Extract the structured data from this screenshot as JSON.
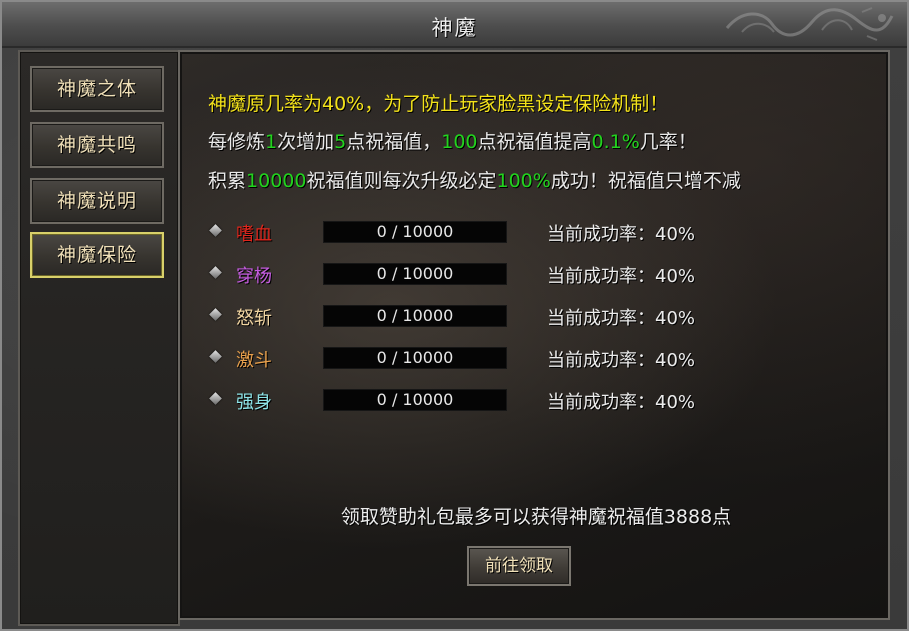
{
  "window": {
    "title": "神魔"
  },
  "sidebar": {
    "items": [
      {
        "label": "神魔之体"
      },
      {
        "label": "神魔共鸣"
      },
      {
        "label": "神魔说明"
      },
      {
        "label": "神魔保险"
      }
    ]
  },
  "intro": {
    "line1": "神魔原几率为40%，为了防止玩家脸黑设定保险机制！",
    "line2_a": "每修炼",
    "line2_b": "1",
    "line2_c": "次增加",
    "line2_d": "5",
    "line2_e": "点祝福值，",
    "line2_f": "100",
    "line2_g": "点祝福值提高",
    "line2_h": "0.1%",
    "line2_i": "几率！",
    "line3_a": "积累",
    "line3_b": "10000",
    "line3_c": "祝福值则每次升级必定",
    "line3_d": "100%",
    "line3_e": "成功！祝福值只增不减"
  },
  "rows": [
    {
      "name": "嗜血",
      "color": "#e0261c",
      "progress": "0 / 10000",
      "progress_value": 0,
      "progress_max": 10000,
      "rate": "当前成功率：40%"
    },
    {
      "name": "穿杨",
      "color": "#c55ce0",
      "progress": "0 / 10000",
      "progress_value": 0,
      "progress_max": 10000,
      "rate": "当前成功率：40%"
    },
    {
      "name": "怒斩",
      "color": "#f0d4a0",
      "progress": "0 / 10000",
      "progress_value": 0,
      "progress_max": 10000,
      "rate": "当前成功率：40%"
    },
    {
      "name": "激斗",
      "color": "#e8a04c",
      "progress": "0 / 10000",
      "progress_value": 0,
      "progress_max": 10000,
      "rate": "当前成功率：40%"
    },
    {
      "name": "强身",
      "color": "#8ee4e8",
      "progress": "0 / 10000",
      "progress_value": 0,
      "progress_max": 10000,
      "rate": "当前成功率：40%"
    }
  ],
  "footer": {
    "note": "领取赞助礼包最多可以获得神魔祝福值3888点",
    "button": "前往领取"
  },
  "icons": {
    "row_marker": "diamond-icon",
    "title_decoration": "dragon-ornament-icon"
  }
}
